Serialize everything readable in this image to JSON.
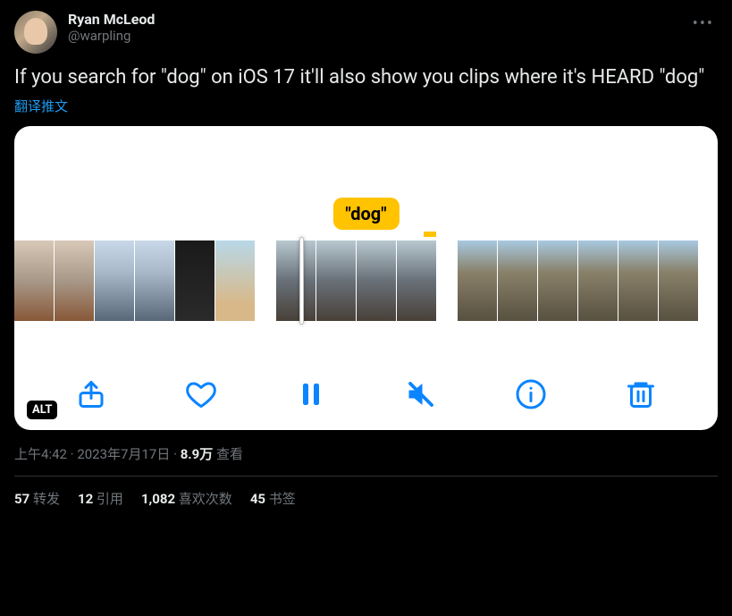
{
  "author": {
    "display_name": "Ryan McLeod",
    "handle": "@warpling"
  },
  "tweet_text": "If you search for \"dog\" on iOS 17 it'll also show you clips where it's HEARD \"dog\"",
  "translate_label": "翻译推文",
  "media": {
    "highlighted_term": "\"dog\"",
    "alt_badge": "ALT"
  },
  "meta": {
    "time": "上午4:42",
    "separator": "·",
    "date": "2023年7月17日",
    "views_count": "8.9万",
    "views_label": "查看"
  },
  "stats": {
    "retweets_count": "57",
    "retweets_label": "转发",
    "quotes_count": "12",
    "quotes_label": "引用",
    "likes_count": "1,082",
    "likes_label": "喜欢次数",
    "bookmarks_count": "45",
    "bookmarks_label": "书签"
  }
}
